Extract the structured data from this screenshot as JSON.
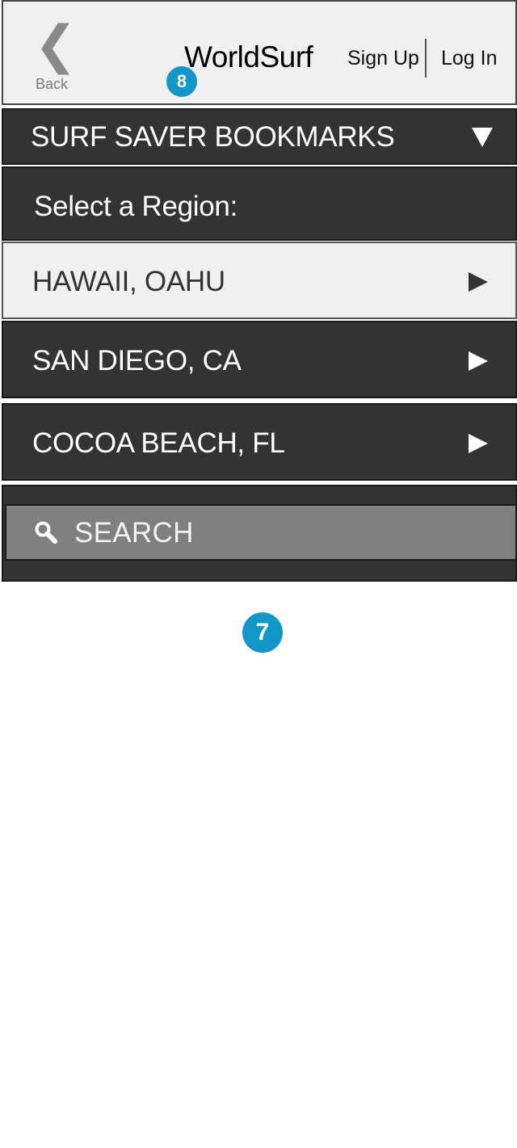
{
  "header": {
    "back_icon": "chevron-left-icon",
    "back_label": "Back",
    "title": "WorldSurf",
    "sign_up_label": "Sign Up",
    "log_in_label": "Log In"
  },
  "markers": {
    "header_marker": "8",
    "page_marker": "7"
  },
  "bookmarks": {
    "title": "SURF SAVER BOOKMARKS",
    "toggle_icon": "triangle-down-icon"
  },
  "regions": {
    "label": "Select a Region:",
    "items": [
      {
        "label": "HAWAII, OAHU",
        "selected": true
      },
      {
        "label": "SAN DIEGO, CA",
        "selected": false
      },
      {
        "label": "COCOA BEACH, FL",
        "selected": false
      }
    ],
    "arrow_icon": "triangle-right-icon"
  },
  "search": {
    "placeholder": "SEARCH",
    "icon": "search-icon"
  },
  "colors": {
    "dark_bar": "#333333",
    "light_bar": "#f0f0f0",
    "search_field": "#808080",
    "marker": "#1396c8"
  }
}
